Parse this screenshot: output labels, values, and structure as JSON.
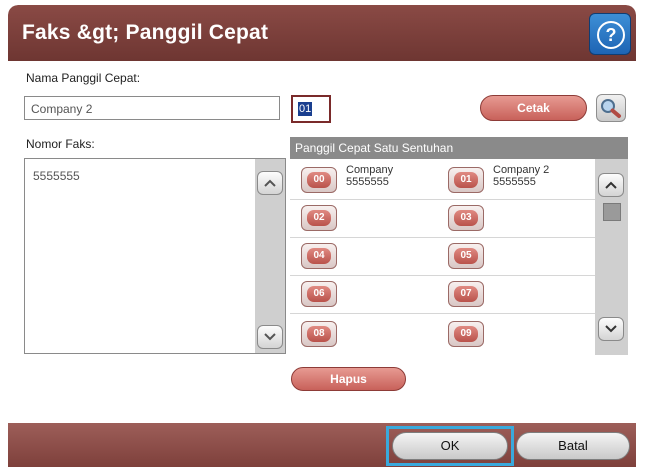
{
  "header": {
    "title": "Faks &gt; Panggil Cepat",
    "help_glyph": "?"
  },
  "form": {
    "name_label": "Nama Panggil Cepat:",
    "name_value": "Company 2",
    "code_value": "01",
    "print_label": "Cetak",
    "fax_label": "Nomor Faks:",
    "fax_value": "5555555"
  },
  "speed_dial": {
    "header": "Panggil Cepat Satu Sentuhan",
    "slots": [
      {
        "code": "00",
        "name": "Company",
        "number": "5555555"
      },
      {
        "code": "01",
        "name": "Company 2",
        "number": "5555555"
      },
      {
        "code": "02",
        "name": "",
        "number": ""
      },
      {
        "code": "03",
        "name": "",
        "number": ""
      },
      {
        "code": "04",
        "name": "",
        "number": ""
      },
      {
        "code": "05",
        "name": "",
        "number": ""
      },
      {
        "code": "06",
        "name": "",
        "number": ""
      },
      {
        "code": "07",
        "name": "",
        "number": ""
      },
      {
        "code": "08",
        "name": "",
        "number": ""
      },
      {
        "code": "09",
        "name": "",
        "number": ""
      }
    ]
  },
  "actions": {
    "delete_label": "Hapus",
    "ok_label": "OK",
    "cancel_label": "Batal"
  },
  "icons": {
    "help": "help-icon",
    "search": "search-icon",
    "scroll_up": "chevron-up-icon",
    "scroll_down": "chevron-down-icon"
  },
  "colors": {
    "title_bar": "#6e3632",
    "accent_button": "#c8615a",
    "focus_frame": "#39a9dc",
    "help_button": "#1e64b4"
  }
}
